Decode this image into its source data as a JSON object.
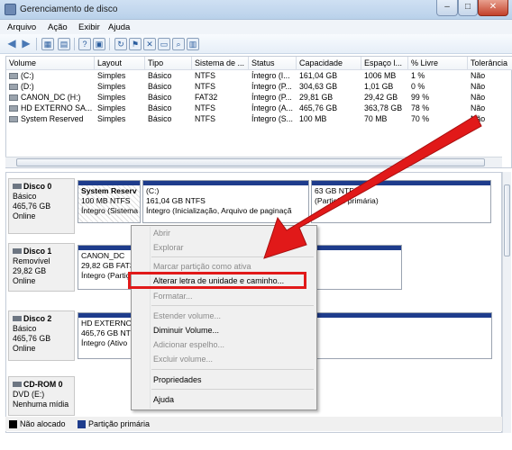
{
  "window": {
    "title": "Gerenciamento de disco",
    "min": "–",
    "max": "□",
    "close": "✕"
  },
  "menu": [
    "Arquivo",
    "Ação",
    "Exibir",
    "Ajuda"
  ],
  "table": {
    "headers": [
      "Volume",
      "Layout",
      "Tipo",
      "Sistema de ...",
      "Status",
      "Capacidade",
      "Espaço l...",
      "% Livre",
      "Tolerância"
    ],
    "rows": [
      [
        "(C:)",
        "Simples",
        "Básico",
        "NTFS",
        "Íntegro (I...",
        "161,04 GB",
        "1006 MB",
        "1 %",
        "Não"
      ],
      [
        "(D:)",
        "Simples",
        "Básico",
        "NTFS",
        "Íntegro (P...",
        "304,63 GB",
        "1,01 GB",
        "0 %",
        "Não"
      ],
      [
        "CANON_DC (H:)",
        "Simples",
        "Básico",
        "FAT32",
        "Íntegro (P...",
        "29,81 GB",
        "29,42 GB",
        "99 %",
        "Não"
      ],
      [
        "HD EXTERNO SA...",
        "Simples",
        "Básico",
        "NTFS",
        "Íntegro (A...",
        "465,76 GB",
        "363,78 GB",
        "78 %",
        "Não"
      ],
      [
        "System Reserved",
        "Simples",
        "Básico",
        "NTFS",
        "Íntegro (S...",
        "100 MB",
        "70 MB",
        "70 %",
        "Não"
      ]
    ]
  },
  "disks": [
    {
      "name": "Disco 0",
      "l1": "Básico",
      "l2": "465,76 GB",
      "l3": "Online"
    },
    {
      "name": "Disco 1",
      "l1": "Removível",
      "l2": "29,82 GB",
      "l3": "Online"
    },
    {
      "name": "Disco 2",
      "l1": "Básico",
      "l2": "465,76 GB",
      "l3": "Online"
    },
    {
      "name": "CD-ROM 0",
      "l1": "DVD (E:)",
      "l2": "",
      "l3": "Nenhuma mídia"
    }
  ],
  "partitions": {
    "d0p1": {
      "l1": "System Reserv",
      "l2": "100 MB NTFS",
      "l3": "Íntegro (Sistema"
    },
    "d0p2": {
      "l1": "(C:)",
      "l2": "161,04 GB NTFS",
      "l3": "Íntegro (Inicialização, Arquivo de paginaçã"
    },
    "d0p3": {
      "l1": "",
      "l2": "63 GB NTFS",
      "l3": "(Partição primária)"
    },
    "d1p1": {
      "l1": "CANON_DC",
      "l2": "29,82 GB FAT3",
      "l3": "Íntegro (Partiç"
    },
    "d2p1": {
      "l1": "HD EXTERNO",
      "l2": "465,76 GB NTF",
      "l3": "Íntegro (Ativo"
    }
  },
  "context_menu": {
    "abrir": "Abrir",
    "explorar": "Explorar",
    "marcar": "Marcar partição como ativa",
    "alterar": "Alterar letra de unidade e caminho...",
    "formatar": "Formatar...",
    "estender": "Estender volume...",
    "diminuir": "Diminuir Volume...",
    "espelho": "Adicionar espelho...",
    "excluir": "Excluir volume...",
    "propriedades": "Propriedades",
    "ajuda": "Ajuda"
  },
  "legend": {
    "unallocated": "Não alocado",
    "primary": "Partição primária",
    "unallocated_color": "#000000",
    "primary_color": "#1e3c8c"
  },
  "accent": {
    "highlight": "#e11919",
    "arrow": "#e11919"
  }
}
